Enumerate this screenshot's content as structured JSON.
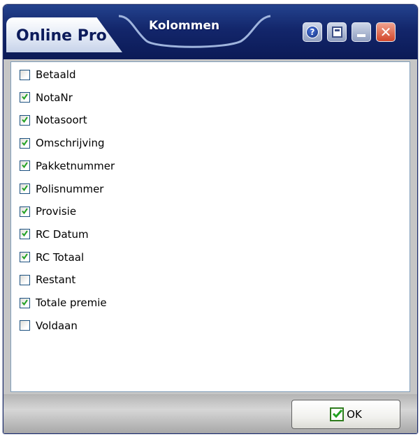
{
  "window": {
    "app_name": "Online Pro",
    "title": "Kolommen"
  },
  "title_buttons": [
    {
      "name": "help-button",
      "icon": "help-icon"
    },
    {
      "name": "restore-button",
      "icon": "restore-icon"
    },
    {
      "name": "minimize-button",
      "icon": "minimize-icon"
    },
    {
      "name": "close-button",
      "icon": "close-icon"
    }
  ],
  "columns": [
    {
      "label": "Betaald",
      "checked": false
    },
    {
      "label": "NotaNr",
      "checked": true
    },
    {
      "label": "Notasoort",
      "checked": true
    },
    {
      "label": "Omschrijving",
      "checked": true
    },
    {
      "label": "Pakketnummer",
      "checked": true
    },
    {
      "label": "Polisnummer",
      "checked": true
    },
    {
      "label": "Provisie",
      "checked": true
    },
    {
      "label": "RC Datum",
      "checked": true
    },
    {
      "label": "RC Totaal",
      "checked": true
    },
    {
      "label": "Restant",
      "checked": false
    },
    {
      "label": "Totale premie",
      "checked": true
    },
    {
      "label": "Voldaan",
      "checked": false
    }
  ],
  "footer": {
    "ok_label": "OK",
    "ok_icon": "green-check-icon"
  },
  "colors": {
    "titlebar": "#13266b",
    "check_green": "#21a121",
    "content_bg": "#c6c6c6"
  }
}
